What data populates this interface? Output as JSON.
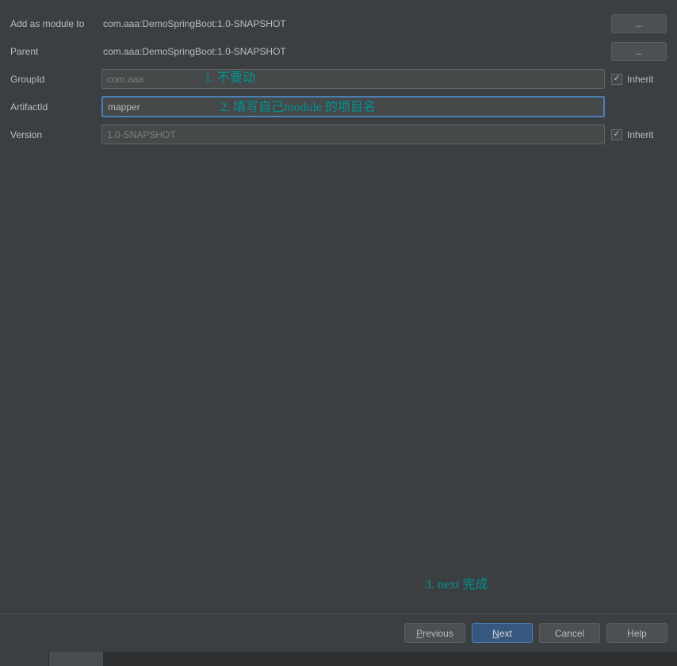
{
  "rows": {
    "addModule": {
      "label": "Add as module to",
      "value": "com.aaa:DemoSpringBoot:1.0-SNAPSHOT"
    },
    "parent": {
      "label": "Parent",
      "value": "com.aaa:DemoSpringBoot:1.0-SNAPSHOT"
    },
    "groupId": {
      "label": "GroupId",
      "value": "com.aaa",
      "inheritLabel": "Inherit",
      "inherited": true
    },
    "artifactId": {
      "label": "ArtifactId",
      "value": "mapper"
    },
    "version": {
      "label": "Version",
      "value": "1.0-SNAPSHOT",
      "inheritLabel": "Inherit",
      "inherited": true
    }
  },
  "ellipsis": "...",
  "annotations": {
    "a1": "1. 不要动",
    "a2": "2. 填写自己module 的项目名",
    "a3": "3. next 完成"
  },
  "buttons": {
    "previous": "Previous",
    "next": "Next",
    "cancel": "Cancel",
    "help": "Help"
  }
}
